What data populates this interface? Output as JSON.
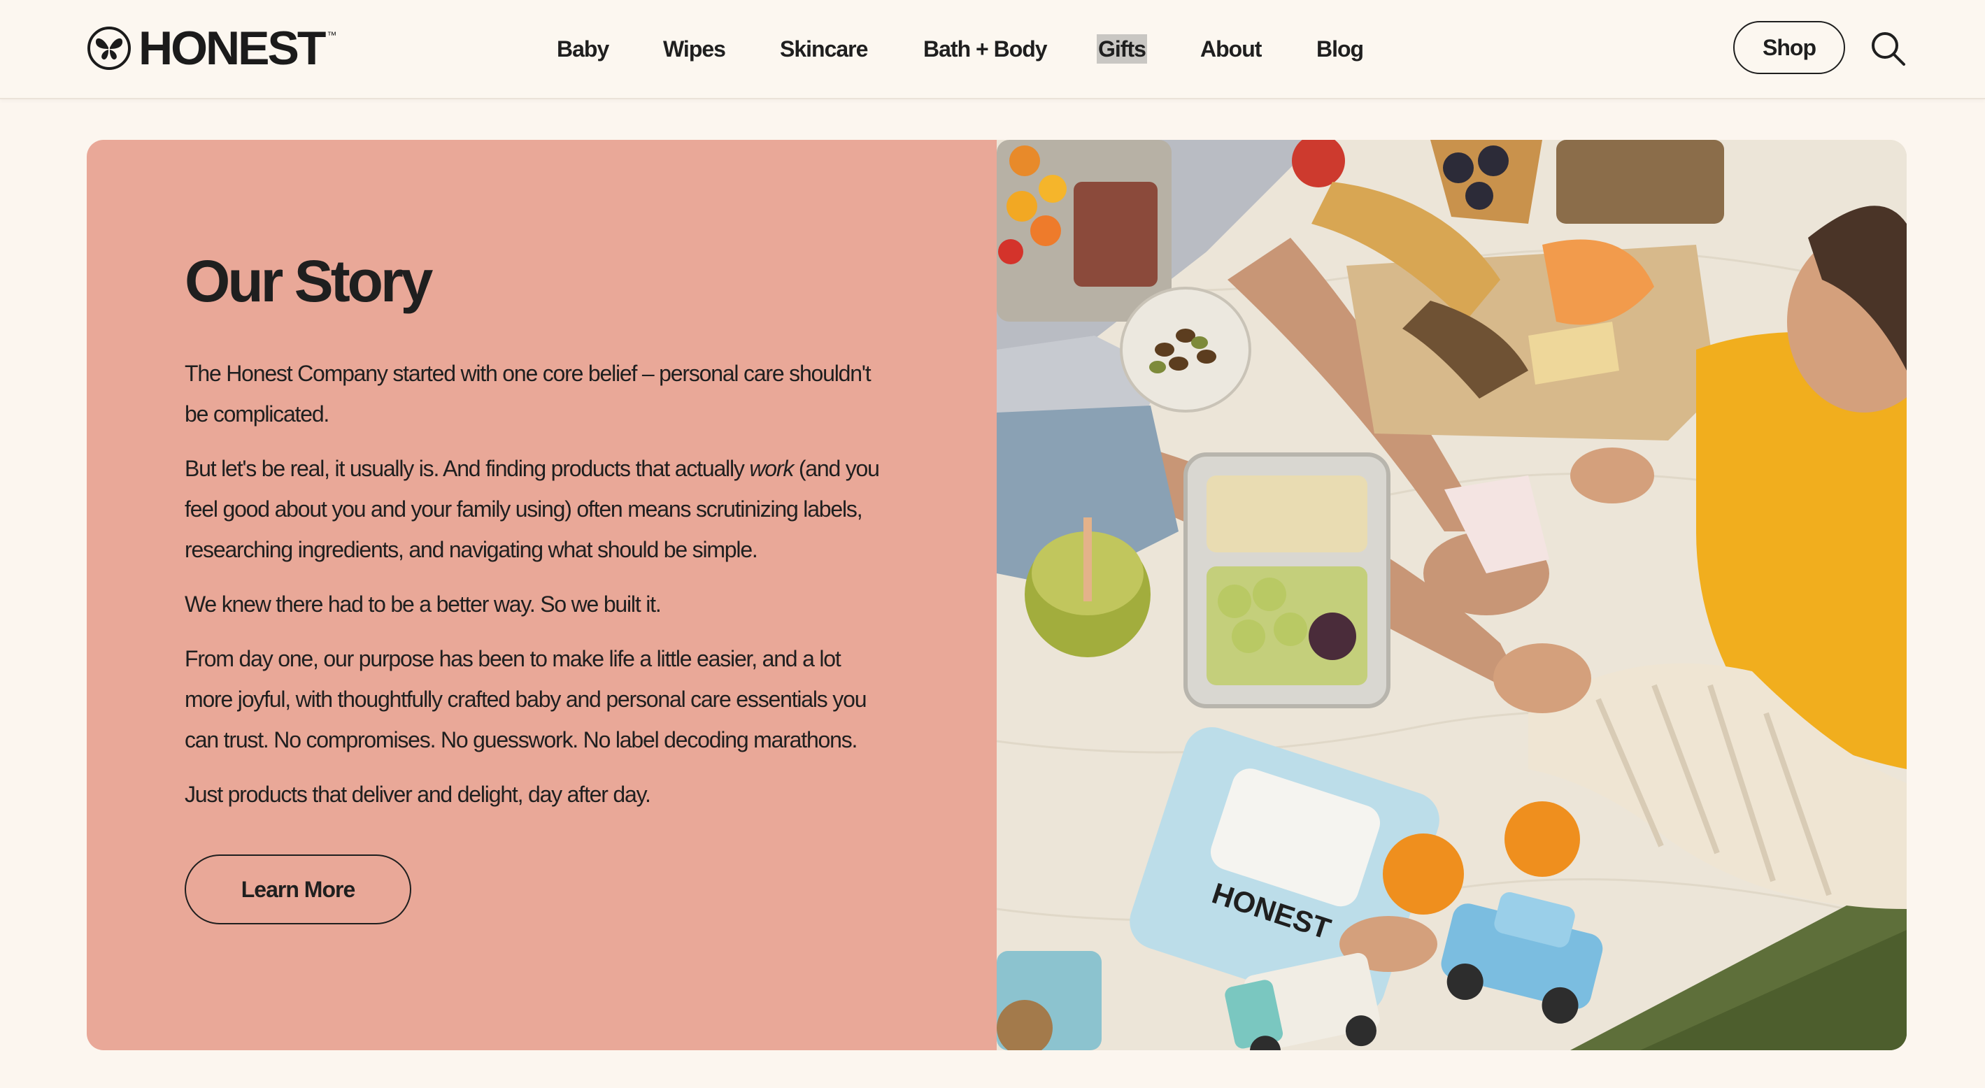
{
  "header": {
    "logo": {
      "wordmark": "HONEST",
      "tm": "™",
      "icon": "butterfly-logo-icon"
    },
    "nav": [
      {
        "label": "Baby"
      },
      {
        "label": "Wipes"
      },
      {
        "label": "Skincare"
      },
      {
        "label": "Bath + Body"
      },
      {
        "label": "Gifts",
        "highlighted": true
      },
      {
        "label": "About"
      },
      {
        "label": "Blog"
      }
    ],
    "shop_label": "Shop",
    "search_icon": "search-icon"
  },
  "story": {
    "title": "Our Story",
    "paragraphs": {
      "p1": "The Honest Company started with one core belief – personal care shouldn't be complicated.",
      "p2_before": "But let's be real, it usually is. And finding products that actually ",
      "p2_em": "work",
      "p2_after": " (and you feel good about you and your family using) often means scrutinizing labels, researching ingredients, and navigating what should be simple.",
      "p3": "We knew there had to be a better way. So we built it.",
      "p4": "From day one, our purpose has been to make life a little easier, and a lot more joyful, with thoughtfully crafted baby and personal care essentials you can trust. No compromises. No guesswork. No label decoding marathons.",
      "p5": "Just products that deliver and delight, day after day."
    },
    "cta_label": "Learn More",
    "photo_icon": "picnic-photo",
    "wipes_label": "HONEST"
  },
  "colors": {
    "page_bg": "#fcf6ef",
    "card_bg": "#e9a898",
    "text": "#1f1f1f",
    "nav_highlight": "#c9c7c3"
  }
}
